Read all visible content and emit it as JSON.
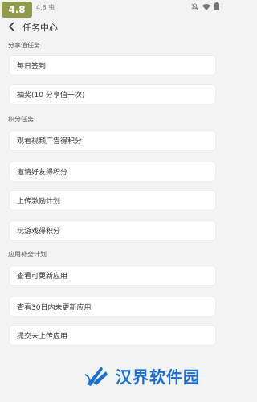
{
  "statusbar": {
    "version_badge": "4.8",
    "left_text": "4.8 虫"
  },
  "header": {
    "title": "任务中心"
  },
  "sections": [
    {
      "title": "分享值任务",
      "items": [
        {
          "label": "每日签到"
        },
        {
          "label": "抽奖(10 分享值一次)"
        }
      ]
    },
    {
      "title": "积分任务",
      "items": [
        {
          "label": "观看视频广告得积分"
        },
        {
          "label": "邀请好友得积分"
        },
        {
          "label": "上传激励计划"
        },
        {
          "label": "玩游戏得积分"
        }
      ]
    },
    {
      "title": "应用补全计划",
      "items": [
        {
          "label": "查看可更新应用"
        },
        {
          "label": "查看30日内未更新应用"
        },
        {
          "label": "提交未上传应用"
        }
      ]
    }
  ],
  "watermark": {
    "text": "汉界软件园"
  },
  "colors": {
    "badge": "#8f9a4a",
    "watermark": "#1c6fcf",
    "background": "#f3f3f3"
  },
  "icons": {
    "back": "back-arrow-icon",
    "mute": "bell-off-icon",
    "wifi": "wifi-icon",
    "battery": "battery-icon"
  }
}
